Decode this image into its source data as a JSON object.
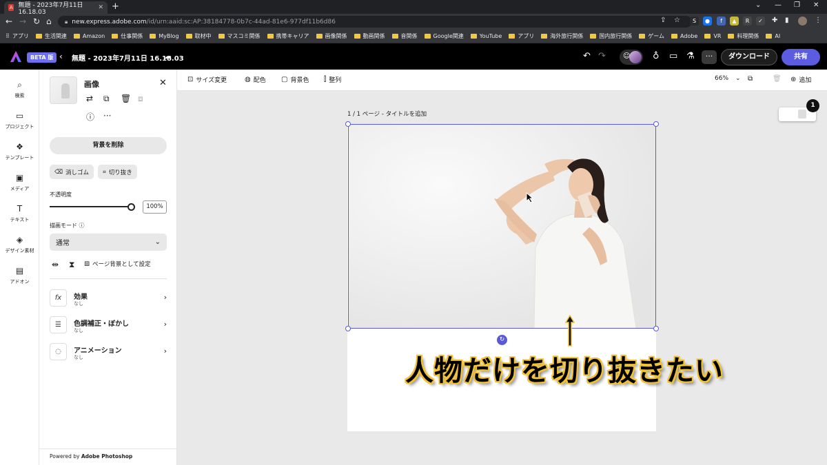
{
  "browser": {
    "tab_title": "無題 - 2023年7月11日 16.18.03",
    "url_host": "new.express.adobe.com",
    "url_path": "/id/urn:aaid:sc:AP:38184778-0b7c-44ad-81e6-977df11b6d86",
    "bookmarks": [
      "アプリ",
      "生活関連",
      "Amazon",
      "仕事関係",
      "MyBlog",
      "取材中",
      "マスコミ関係",
      "携帯キャリア",
      "画像関係",
      "動画関係",
      "音関係",
      "Google関連",
      "YouTube",
      "アプリ",
      "海外旅行関係",
      "国内旅行関係",
      "ゲーム",
      "Adobe",
      "VR",
      "料理関係",
      "AI"
    ]
  },
  "app": {
    "beta_badge": "BETA 版",
    "doc_title": "無題 - 2023年7月11日 16.18.03",
    "download_label": "ダウンロード",
    "share_label": "共有"
  },
  "rail": {
    "items": [
      {
        "label": "検索"
      },
      {
        "label": "プロジェクト"
      },
      {
        "label": "テンプレート"
      },
      {
        "label": "メディア"
      },
      {
        "label": "テキスト"
      },
      {
        "label": "デザイン素材"
      },
      {
        "label": "アドオン"
      }
    ]
  },
  "panel": {
    "title": "画像",
    "remove_bg": "背景を削除",
    "eraser": "消しゴム",
    "crop": "切り抜き",
    "opacity_label": "不透明度",
    "opacity_value": "100%",
    "opacity_level": 1.0,
    "blend_label": "描画モード",
    "blend_value": "通常",
    "set_bg": "ページ背景として設定",
    "props": [
      {
        "title": "効果",
        "sub": "なし",
        "icon": "fx"
      },
      {
        "title": "色調補正・ぼかし",
        "sub": "なし",
        "icon": "sliders"
      },
      {
        "title": "アニメーション",
        "sub": "なし",
        "icon": "animation"
      }
    ],
    "powered_prefix": "Powered by ",
    "powered_brand": "Adobe Photoshop"
  },
  "toolbar": {
    "resize": "サイズ変更",
    "color": "配色",
    "bgcolor": "背景色",
    "align": "整列",
    "zoom": "66%",
    "add": "追加"
  },
  "canvas": {
    "page_label": "1 / 1 ページ - タイトルを追加",
    "overlay_text": "人物だけを切り抜きたい",
    "page_count": "1"
  }
}
